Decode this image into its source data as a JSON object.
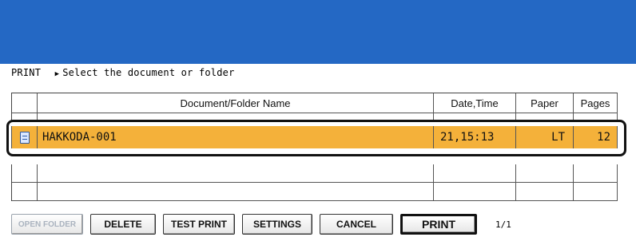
{
  "screen": {
    "banner_color": "#2468c4",
    "selected_color": "#f4b13a"
  },
  "breadcrumb": {
    "mode": "PRINT",
    "instruction": "Select the document or folder"
  },
  "table": {
    "headers": {
      "name": "Document/Folder Name",
      "date": "Date,Time",
      "paper": "Paper",
      "pages": "Pages"
    },
    "selected_row": {
      "icon": "document-icon",
      "name": "HAKKODA-001",
      "date": "21,15:13",
      "paper": "LT",
      "pages": "12"
    }
  },
  "buttons": {
    "open_folder": "OPEN FOLDER",
    "delete": "DELETE",
    "test_print": "TEST PRINT",
    "settings": "SETTINGS",
    "cancel": "CANCEL",
    "print": "PRINT"
  },
  "page_indicator": "1/1"
}
